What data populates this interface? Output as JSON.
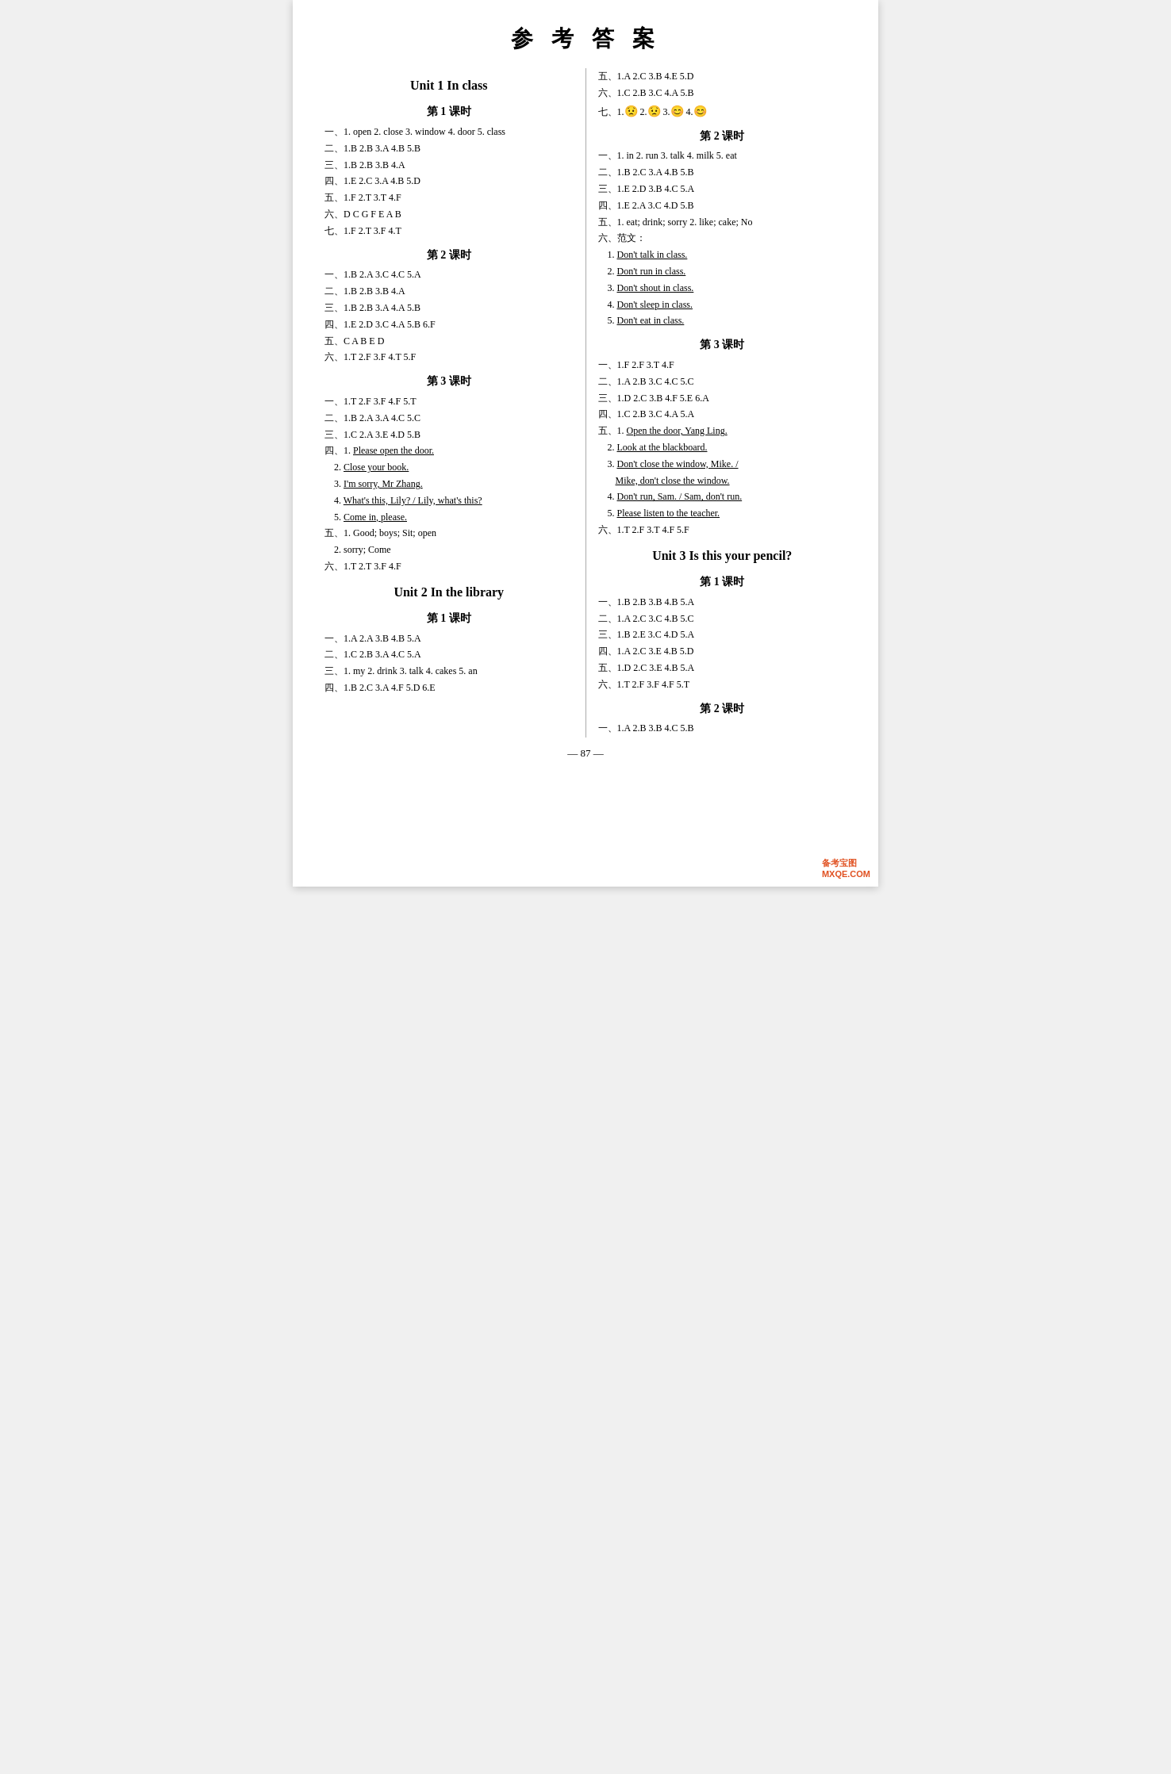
{
  "title": "参 考 答 案",
  "left_column": {
    "unit1": {
      "title": "Unit 1   In class",
      "lesson1": {
        "title": "第 1 课时",
        "lines": [
          "一、1. open  2. close  3. window  4. door  5. class",
          "二、1.B  2.B  3.A  4.B  5.B",
          "三、1.B  2.B  3.B  4.A",
          "四、1.E  2.C  3.A  4.B  5.D",
          "五、1.F  2.T  3.T  4.F",
          "六、D  C  G  F  E  A  B",
          "七、1.F  2.T  3.F  4.T"
        ]
      },
      "lesson2": {
        "title": "第 2 课时",
        "lines": [
          "一、1.B  2.A  3.C  4.C  5.A",
          "二、1.B  2.B  3.B  4.A",
          "三、1.B  2.B  3.A  4.A  5.B",
          "四、1.E  2.D  3.C  4.A  5.B  6.F",
          "五、C  A  B  E  D",
          "六、1.T  2.F  3.F  4.T  5.F"
        ]
      },
      "lesson3": {
        "title": "第 3 课时",
        "lines": [
          "一、1.T  2.F  3.F  4.F  5.T",
          "二、1.B  2.A  3.A  4.C  5.C",
          "三、1.C  2.A  3.E  4.D  5.B"
        ],
        "writing": [
          "四、1. Please open the door.",
          "   2. Close your book.",
          "   3. I'm sorry, Mr Zhang.",
          "   4. What's this, Lily? / Lily, what's this?",
          "   5. Come in, please."
        ],
        "more": [
          "五、1. Good; boys; Sit; open",
          "   2. sorry; Come",
          "六、1.T  2.T  3.F  4.F"
        ]
      }
    },
    "unit2": {
      "title": "Unit 2   In the library",
      "lesson1": {
        "title": "第 1 课时",
        "lines": [
          "一、1.A  2.A  3.B  4.B  5.A",
          "二、1.C  2.B  3.A  4.C  5.A",
          "三、1. my  2. drink  3. talk  4. cakes  5. an",
          "四、1.B  2.C  3.A  4.F  5.D  6.E"
        ]
      }
    }
  },
  "right_column": {
    "unit2_cont": {
      "more_lesson1": [
        "五、1.A  2.C  3.B  4.E  5.D",
        "六、1.C  2.B  3.C  4.A  5.B",
        "七、1.😟  2.😟  3.😊  4.😊"
      ],
      "lesson2": {
        "title": "第 2 课时",
        "lines": [
          "一、1. in  2. run  3. talk  4. milk  5. eat",
          "二、1.B  2.C  3.A  4.B  5.B",
          "三、1.E  2.D  3.B  4.C  5.A",
          "四、1.E  2.A  3.C  4.D  5.B",
          "五、1. eat; drink; sorry  2. like; cake; No",
          "六、范文："
        ],
        "writing": [
          "   1. Don't talk in class.",
          "   2. Don't run in class.",
          "   3. Don't shout in class.",
          "   4. Don't sleep in class.",
          "   5. Don't eat in class."
        ]
      },
      "lesson3": {
        "title": "第 3 课时",
        "lines": [
          "一、1.F  2.F  3.T  4.F",
          "二、1.A  2.B  3.C  4.C  5.C",
          "三、1.D  2.C  3.B  4.F  5.E  6.A",
          "四、1.C  2.B  3.C  4.A  5.A"
        ],
        "writing": [
          "五、1. Open the door, Yang Ling.",
          "   2. Look at the blackboard.",
          "   3. Don't close the window, Mike. /",
          "      Mike, don't close the window.",
          "   4. Don't run, Sam. / Sam, don't run.",
          "   5. Please listen to the teacher."
        ],
        "more": [
          "六、1.T  2.F  3.T  4.F  5.F"
        ]
      }
    },
    "unit3": {
      "title": "Unit 3   Is this your pencil?",
      "lesson1": {
        "title": "第 1 课时",
        "lines": [
          "一、1.B  2.B  3.B  4.B  5.A",
          "二、1.A  2.C  3.C  4.B  5.C",
          "三、1.B  2.E  3.C  4.D  5.A",
          "四、1.A  2.C  3.E  4.B  5.D",
          "五、1.D  2.C  3.E  4.B  5.A",
          "六、1.T  2.F  3.F  4.F  5.T"
        ]
      },
      "lesson2": {
        "title": "第 2 课时",
        "lines": [
          "一、1.A  2.B  3.B  4.C  5.B"
        ]
      }
    }
  },
  "page_number": "— 87 —",
  "watermark": "备考宝图\nMXQE.COM"
}
